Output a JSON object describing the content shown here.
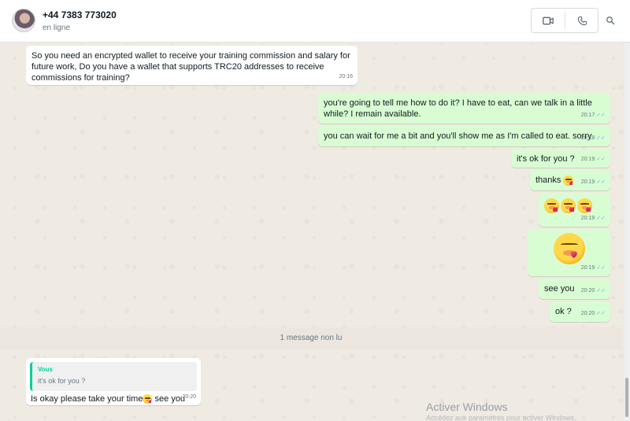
{
  "contact": {
    "phone": "+44 7383 773020",
    "status": "en ligne"
  },
  "icons": {
    "video": "video-camera-icon",
    "call": "phone-icon",
    "search": "search-icon",
    "read_receipt": "double-check-icon"
  },
  "colors": {
    "outgoing_bubble": "#d9fdd3",
    "incoming_bubble": "#ffffff",
    "read_ticks": "#53bdeb",
    "quote_accent": "#06cf9c",
    "chat_bg": "#efeae2"
  },
  "messages": [
    {
      "dir": "in",
      "text": "So you need an encrypted wallet to receive your training commission and salary for future work,  Do you have a wallet that supports TRC20 addresses to receive commissions for training?",
      "time": "20:16"
    },
    {
      "dir": "out",
      "text": "you're going to tell me how to do it? I have to eat, can we talk in a little while? I remain available.",
      "time": "20:17"
    },
    {
      "dir": "out",
      "text": "you can wait for me a bit and you'll show me as I'm called to eat. sorry",
      "time": "20:18"
    },
    {
      "dir": "out",
      "text": "it's ok for you ?",
      "time": "20:19"
    },
    {
      "dir": "out",
      "text": "thanks",
      "emoji": "face-blowing-kiss",
      "time": "20:19"
    },
    {
      "dir": "out",
      "text": "",
      "emoji": "face-blowing-kiss x3",
      "time": "20:19"
    },
    {
      "dir": "out",
      "text": "",
      "emoji": "face-blowing-kiss large",
      "time": "20:19"
    },
    {
      "dir": "out",
      "text": "see you",
      "time": "20:20"
    },
    {
      "dir": "out",
      "text": "ok ?",
      "time": "20:20"
    }
  ],
  "ticks": "✓✓",
  "unread": "1 message non lu",
  "reply": {
    "quote_author": "Vous",
    "quote_text": "it's ok for you ?",
    "text_before": "Is okay please take your time",
    "emoji": "face-blowing-kiss",
    "text_after": " see you",
    "time": "20:20"
  },
  "watermark": {
    "title": "Activer Windows",
    "subtitle": "Accédez aux paramètres pour activer Windows."
  }
}
